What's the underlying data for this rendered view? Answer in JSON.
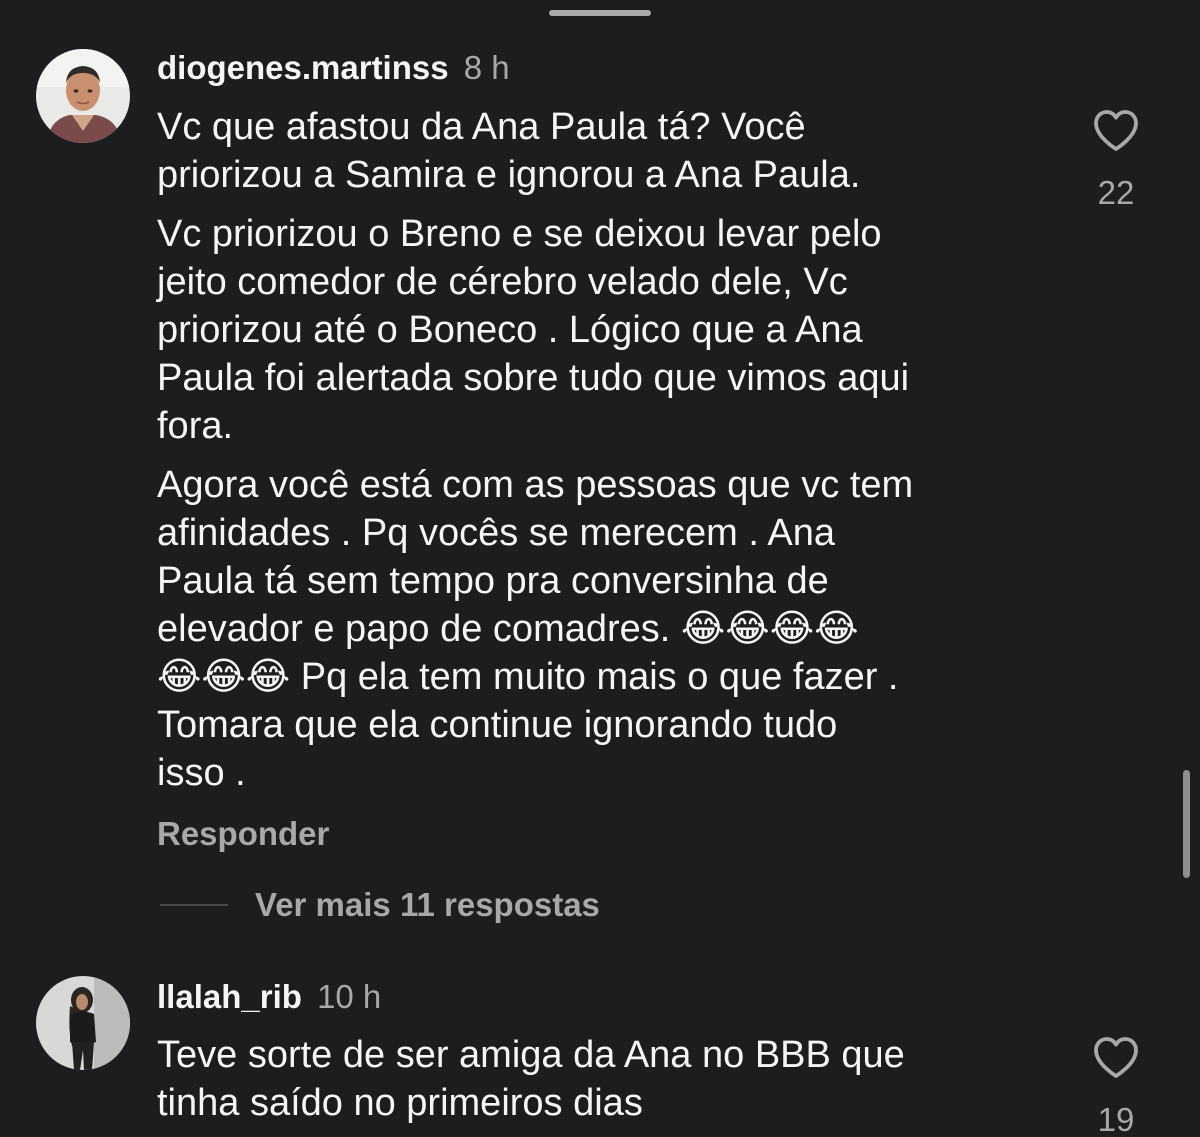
{
  "comments": [
    {
      "username": "diogenes.martinss",
      "time": "8 h",
      "paragraphs": [
        "Vc que afastou da Ana Paula tá?  Você\npriorizou a Samira e ignorou a Ana Paula.",
        "Vc priorizou o Breno e se deixou levar pelo\njeito comedor de cérebro velado dele,  Vc\npriorizou até o Boneco .  Lógico que a Ana\nPaula foi alertada sobre tudo que vimos aqui\nfora.",
        "Agora você está com as pessoas que vc tem\nafinidades .  Pq vocês se merecem .  Ana\nPaula tá sem tempo pra conversinha de\nelevador e papo de comadres. 😂😂😂😂\n😂😂😂 Pq ela tem muito mais o que fazer .\nTomara que ela continue ignorando tudo\nisso ."
      ],
      "likes": "22",
      "reply_label": "Responder",
      "view_replies_label": "Ver mais 11 respostas",
      "avatar_icon": "profile-photo-man"
    },
    {
      "username": "llalah_rib",
      "time": "10 h",
      "paragraphs": [
        "Teve sorte de ser amiga da Ana no BBB que\ntinha saído no primeiros dias"
      ],
      "likes": "19",
      "avatar_icon": "profile-photo-woman"
    }
  ],
  "icons": {
    "like": "heart-outline-icon"
  },
  "colors": {
    "background": "#1c1d1f",
    "primary_text": "#f5f5f5",
    "secondary_text": "#a8a8a8"
  }
}
